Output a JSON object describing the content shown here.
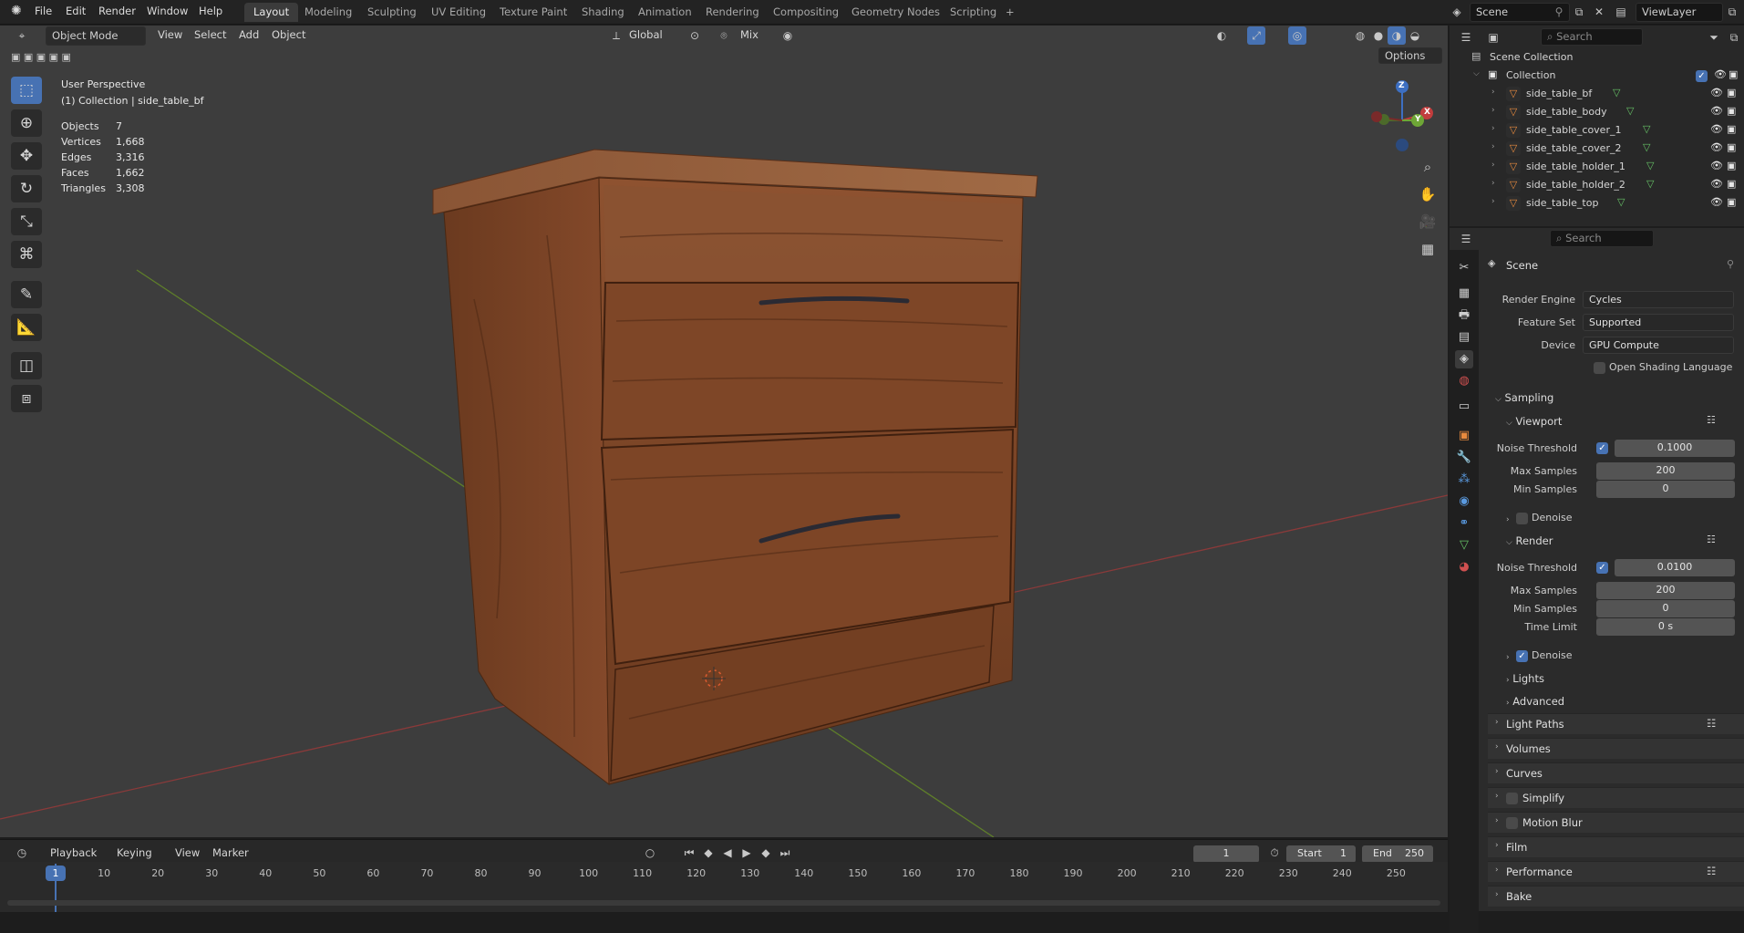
{
  "topbar": {
    "menus": [
      "File",
      "Edit",
      "Render",
      "Window",
      "Help"
    ],
    "workspaces": [
      "Layout",
      "Modeling",
      "Sculpting",
      "UV Editing",
      "Texture Paint",
      "Shading",
      "Animation",
      "Rendering",
      "Compositing",
      "Geometry Nodes",
      "Scripting"
    ],
    "active_workspace": "Layout",
    "add_tab": "+",
    "scene_name": "Scene",
    "view_layer": "ViewLayer"
  },
  "viewport": {
    "mode": "Object Mode",
    "menus": [
      "View",
      "Select",
      "Add",
      "Object"
    ],
    "transform_orientation": "Global",
    "snap_mode": "Mix",
    "options_label": "Options",
    "overlay_title": "User Perspective",
    "overlay_collection": "(1) Collection | side_table_bf",
    "stats": [
      {
        "label": "Objects",
        "value": "7"
      },
      {
        "label": "Vertices",
        "value": "1,668"
      },
      {
        "label": "Edges",
        "value": "3,316"
      },
      {
        "label": "Faces",
        "value": "1,662"
      },
      {
        "label": "Triangles",
        "value": "3,308"
      }
    ],
    "gizmo": {
      "z": "Z",
      "y": "Y",
      "x": "X"
    }
  },
  "outliner": {
    "search_placeholder": "Search",
    "root": "Scene Collection",
    "collection": "Collection",
    "objects": [
      "side_table_bf",
      "side_table_body",
      "side_table_cover_1",
      "side_table_cover_2",
      "side_table_holder_1",
      "side_table_holder_2",
      "side_table_top"
    ]
  },
  "properties": {
    "search_placeholder": "Search",
    "context": "Scene",
    "render_engine_label": "Render Engine",
    "render_engine": "Cycles",
    "feature_set_label": "Feature Set",
    "feature_set": "Supported",
    "device_label": "Device",
    "device": "GPU Compute",
    "osl_label": "Open Shading Language",
    "sampling": "Sampling",
    "viewport_sub": "Viewport",
    "noise_threshold_label": "Noise Threshold",
    "vp_noise_threshold": "0.1000",
    "max_samples_label": "Max Samples",
    "vp_max_samples": "200",
    "min_samples_label": "Min Samples",
    "vp_min_samples": "0",
    "denoise_label": "Denoise",
    "render_sub": "Render",
    "r_noise_threshold": "0.0100",
    "r_max_samples": "200",
    "r_min_samples": "0",
    "time_limit_label": "Time Limit",
    "r_time_limit": "0 s",
    "lights": "Lights",
    "advanced": "Advanced",
    "panels": [
      "Light Paths",
      "Volumes",
      "Curves",
      "Simplify",
      "Motion Blur",
      "Film",
      "Performance",
      "Bake"
    ]
  },
  "timeline": {
    "menus": [
      "Playback",
      "Keying",
      "View",
      "Marker"
    ],
    "current_frame": "1",
    "start_label": "Start",
    "start": "1",
    "end_label": "End",
    "end": "250",
    "ruler": [
      "1",
      "10",
      "20",
      "30",
      "40",
      "50",
      "60",
      "70",
      "80",
      "90",
      "100",
      "110",
      "120",
      "130",
      "140",
      "150",
      "160",
      "170",
      "180",
      "190",
      "200",
      "210",
      "220",
      "230",
      "240",
      "250"
    ]
  }
}
